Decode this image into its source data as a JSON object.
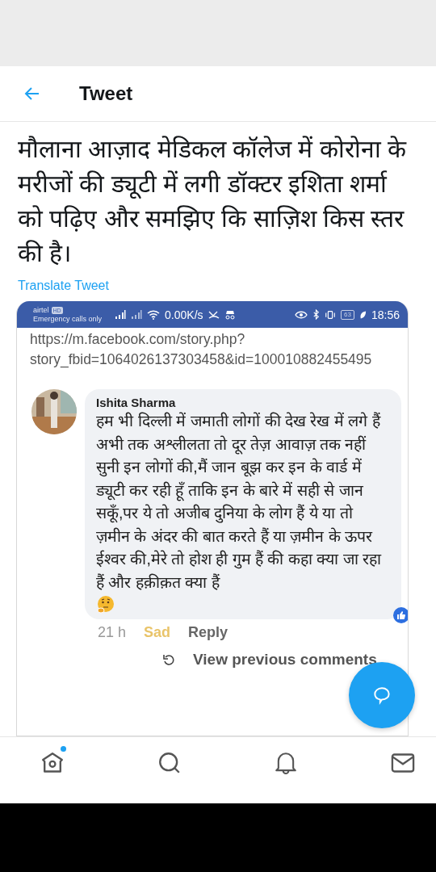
{
  "header": {
    "title": "Tweet"
  },
  "tweet": {
    "text": "मौलाना आज़ाद मेडिकल कॉलेज में कोरोना के मरीजों की ड्यूटी में लगी डॉक्टर इशिता शर्मा को पढ़िए और समझिए कि साज़िश किस स्तर की है।",
    "translate_link": "Translate Tweet"
  },
  "embedded_screenshot": {
    "status_bar": {
      "carrier": "airtel",
      "network_badge": "HD",
      "emergency": "Emergency calls only",
      "speed": "0.00K/s",
      "battery": "63",
      "time": "18:56"
    },
    "url": "https://m.facebook.com/story.php?story_fbid=1064026137303458&id=100010882455495",
    "comment": {
      "author": "Ishita Sharma",
      "text": "हम भी दिल्ली में जमाती लोगों की देख रेख में लगे हैं अभी तक अश्लीलता तो दूर तेज़ आवाज़ तक नहीं सुनी इन लोगों की,मैं जान बूझ कर इन के वार्ड में ड्यूटी कर रही हूँ ताकि इन के बारे में सही से जान सकूँ,पर ये तो अजीब दुनिया के लोग हैं ये या तो ज़मीन के अंदर की बात करते हैं या ज़मीन के ऊपर ईश्वर की,मेरे तो होश ही गुम हैं की कहा क्या जा रहा हैं और हक़ीक़त क्या हैं",
      "time": "21 h",
      "reaction": "Sad",
      "reply": "Reply"
    },
    "view_previous": "View previous comments"
  },
  "bottom_nav": [
    {
      "kind": "home",
      "selected": false,
      "badge": true
    },
    {
      "kind": "search",
      "selected": false,
      "badge": false
    },
    {
      "kind": "notifications",
      "selected": false,
      "badge": false
    },
    {
      "kind": "messages",
      "selected": false,
      "badge": false
    }
  ]
}
